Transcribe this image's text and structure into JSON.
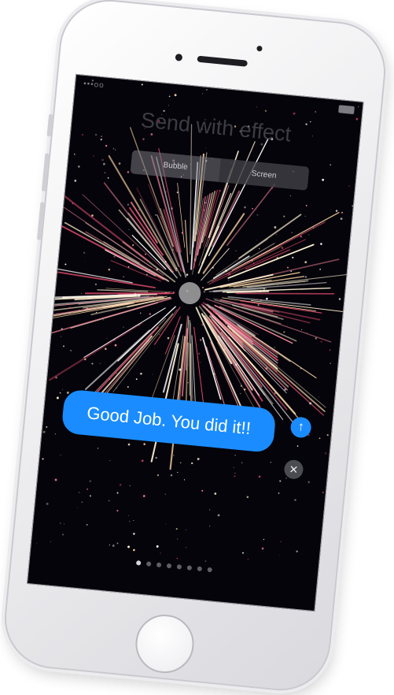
{
  "status_bar": {
    "carrier": "•••oo",
    "time": ""
  },
  "effect_screen": {
    "title": "Send with effect",
    "segments": [
      {
        "label": "Bubble",
        "active": false
      },
      {
        "label": "Screen",
        "active": true
      }
    ],
    "message": "Good Job.  You did it!!",
    "send_icon": "arrow-up-icon",
    "cancel_icon": "close-icon",
    "page_dots": {
      "count": 8,
      "active_index": 0
    }
  },
  "colors": {
    "bubble": "#1a8cff",
    "screen": "#05040a",
    "phone_body": "#eeeef0"
  }
}
